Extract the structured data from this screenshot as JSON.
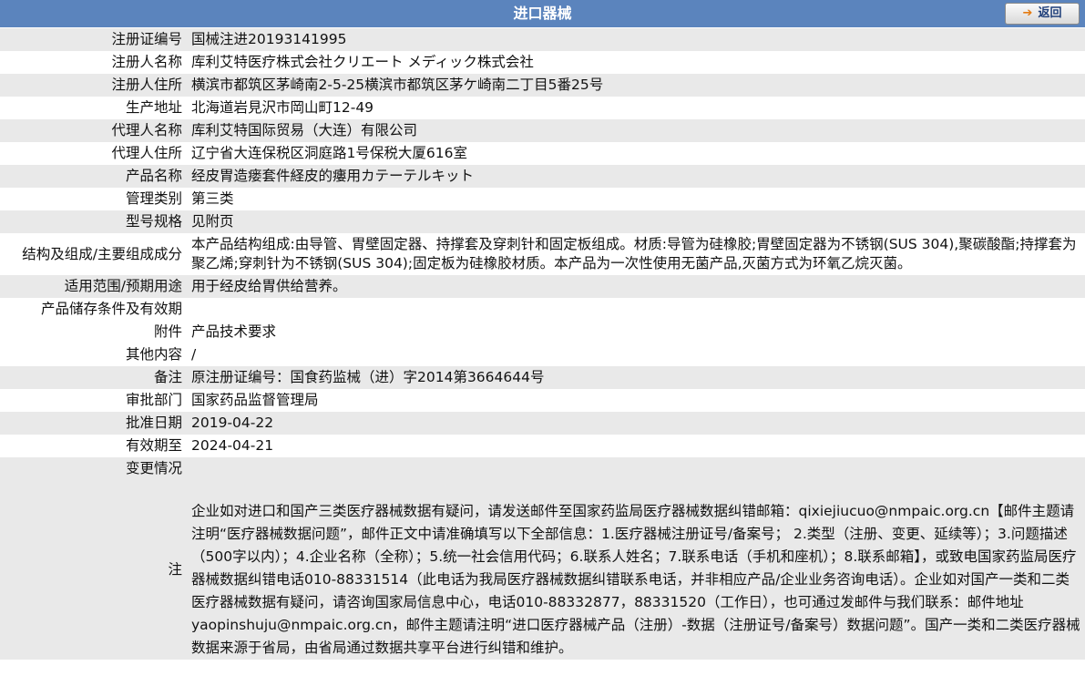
{
  "header": {
    "title": "进口器械",
    "back_label": "返回"
  },
  "rows": [
    {
      "label": "注册证编号",
      "value": "国械注进20193141995"
    },
    {
      "label": "注册人名称",
      "value": "库利艾特医疗株式会社クリエート メディック株式会社"
    },
    {
      "label": "注册人住所",
      "value": "横滨市都筑区茅崎南2-5-25横滨市都筑区茅ケ崎南二丁目5番25号"
    },
    {
      "label": "生产地址",
      "value": "北海道岩見沢市岡山町12-49"
    },
    {
      "label": "代理人名称",
      "value": "库利艾特国际贸易（大连）有限公司"
    },
    {
      "label": "代理人住所",
      "value": "辽宁省大连保税区洞庭路1号保税大厦616室"
    },
    {
      "label": "产品名称",
      "value": "经皮胃造瘘套件経皮的瘻用カテーテルキット"
    },
    {
      "label": "管理类别",
      "value": "第三类"
    },
    {
      "label": "型号规格",
      "value": "见附页"
    },
    {
      "label": "结构及组成/主要组成成分",
      "value": "本产品结构组成:由导管、胃壁固定器、持撑套及穿刺针和固定板组成。材质:导管为硅橡胶;胃壁固定器为不锈钢(SUS 304),聚碳酸酯;持撑套为聚乙烯;穿刺针为不锈钢(SUS 304);固定板为硅橡胶材质。本产品为一次性使用无菌产品,灭菌方式为环氧乙烷灭菌。"
    },
    {
      "label": "适用范围/预期用途",
      "value": "用于经皮给胃供给营养。"
    },
    {
      "label": "产品储存条件及有效期",
      "value": ""
    },
    {
      "label": "附件",
      "value": "产品技术要求"
    },
    {
      "label": "其他内容",
      "value": "/"
    },
    {
      "label": "备注",
      "value": "原注册证编号：国食药监械（进）字2014第3664644号"
    },
    {
      "label": "审批部门",
      "value": "国家药品监督管理局"
    },
    {
      "label": "批准日期",
      "value": "2019-04-22"
    },
    {
      "label": "有效期至",
      "value": "2024-04-21"
    },
    {
      "label": "变更情况",
      "value": ""
    }
  ],
  "note": {
    "label": "注",
    "text": "企业如对进口和国产三类医疗器械数据有疑问，请发送邮件至国家药监局医疗器械数据纠错邮箱：qixiejiucuo@nmpaic.org.cn【邮件主题请注明“医疗器械数据问题”，邮件正文中请准确填写以下全部信息：1.医疗器械注册证号/备案号； 2.类型（注册、变更、延续等）；3.问题描述（500字以内）；4.企业名称（全称）；5.统一社会信用代码；6.联系人姓名；7.联系电话（手机和座机）；8.联系邮箱】，或致电国家药监局医疗器械数据纠错电话010-88331514（此电话为我局医疗器械数据纠错联系电话，并非相应产品/企业业务咨询电话）。企业如对国产一类和二类医疗器械数据有疑问，请咨询国家局信息中心，电话010-88332877，88331520（工作日），也可通过发邮件与我们联系：邮件地址yaopinshuju@nmpaic.org.cn，邮件主题请注明“进口医疗器械产品（注册）-数据（注册证号/备案号）数据问题”。国产一类和二类医疗器械数据来源于省局，由省局通过数据共享平台进行纠错和维护。"
  }
}
